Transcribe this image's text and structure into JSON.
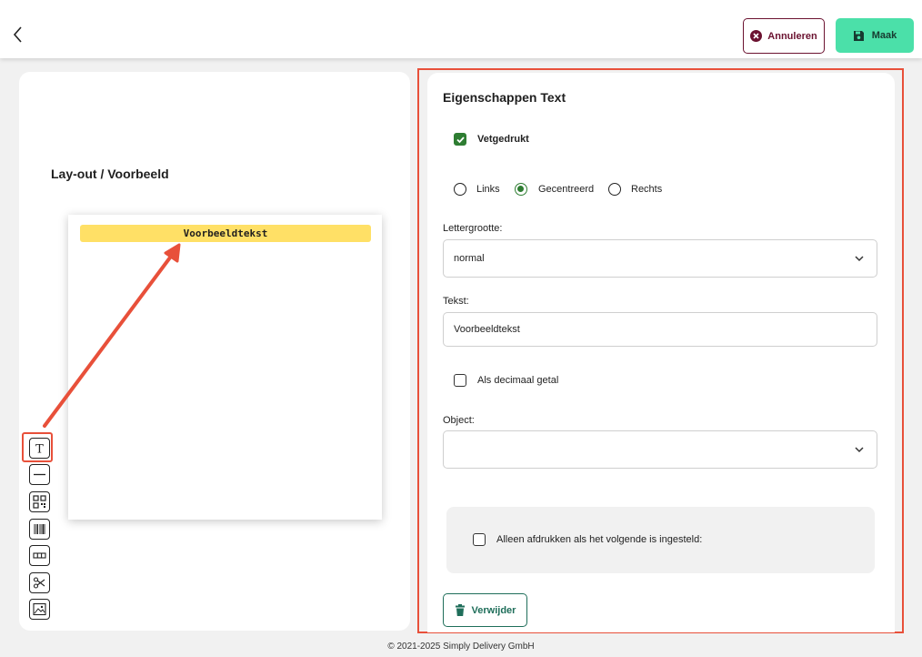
{
  "header": {
    "back_icon": "chevron-left-icon",
    "cancel_label": "Annuleren",
    "cancel_icon": "x-circle-icon",
    "save_label": "Maak",
    "save_icon": "floppy-disk-icon"
  },
  "left": {
    "title": "Lay-out / Voorbeeld",
    "preview_text": "Voorbeeldtekst",
    "tools": [
      "text-tool-icon",
      "line-tool-icon",
      "qr-code-tool-icon",
      "barcode-tool-icon",
      "table-tool-icon",
      "scissors-tool-icon",
      "image-tool-icon"
    ]
  },
  "properties": {
    "title": "Eigenschappen Text",
    "bold_label": "Vetgedrukt",
    "bold_checked": true,
    "align_options": [
      "Links",
      "Gecentreerd",
      "Rechts"
    ],
    "align_selected": "Gecentreerd",
    "font_size_label": "Lettergrootte:",
    "font_size_value": "normal",
    "text_label": "Tekst:",
    "text_value": "Voorbeeldtekst",
    "decimal_label": "Als decimaal getal",
    "object_label": "Object:",
    "object_value": "",
    "condition_label": "Alleen afdrukken als het volgende is ingesteld:",
    "delete_label": "Verwijder"
  },
  "footer": {
    "copyright": "© 2021-2025 Simply Delivery GmbH"
  },
  "colors": {
    "accent_green": "#2e7d32",
    "save_green": "#4be0a9",
    "cancel_maroon": "#6b1230",
    "highlight_red": "#e8503a",
    "preview_yellow": "#ffe066"
  }
}
